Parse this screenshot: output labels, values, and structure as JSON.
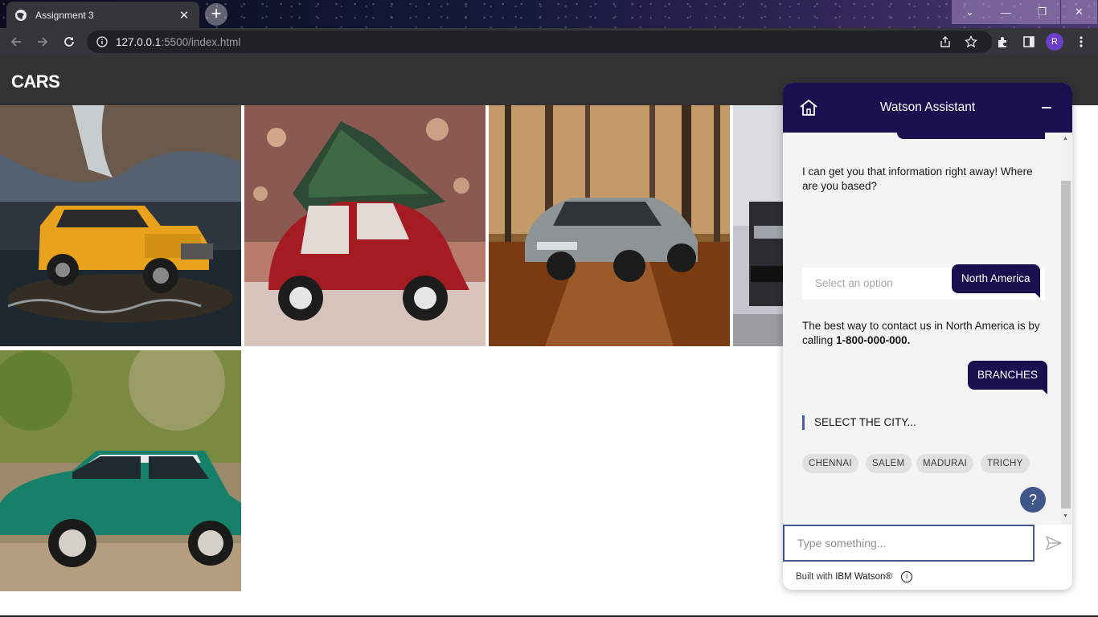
{
  "browser": {
    "tab_title": "Assignment 3",
    "new_tab_symbol": "+",
    "url_host": "127.0.0.1",
    "url_path": ":5500/index.html",
    "profile_initial": "R"
  },
  "page": {
    "title": "CARS",
    "photos": [
      {
        "name": "yellow-hummer-photo"
      },
      {
        "name": "red-beetle-tree-photo"
      },
      {
        "name": "grey-bmw-forest-photo"
      },
      {
        "name": "black-car-photo"
      },
      {
        "name": "green-mini-photo"
      }
    ]
  },
  "assistant": {
    "title": "Watson Assistant",
    "greeting": "I can get you that information right away! Where are you based?",
    "select_placeholder": "Select an option",
    "user_reply_1": "North America",
    "contact_text": "The best way to contact us in North America is by calling ",
    "contact_phone": "1-800-000-000.",
    "user_reply_2": "BRANCHES",
    "city_prompt": "SELECT THE CITY...",
    "cities": [
      "CHENNAI",
      "SALEM",
      "MADURAI",
      "TRICHY"
    ],
    "help_symbol": "?",
    "input_placeholder": "Type something...",
    "footer_prefix": "Built with ",
    "footer_brand": "IBM Watson®",
    "info_symbol": "i"
  },
  "colors": {
    "header_bg": "#333333",
    "assistant_brand": "#1a0f4f",
    "assistant_accent": "#41578b"
  }
}
